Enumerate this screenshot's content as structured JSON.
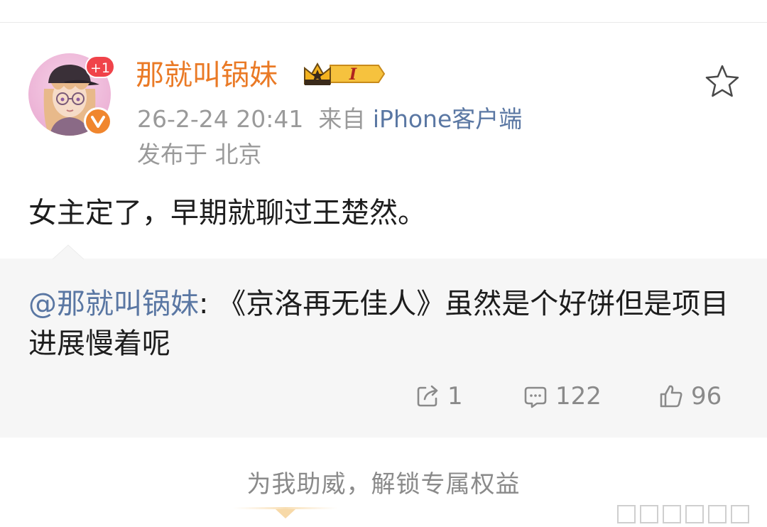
{
  "post": {
    "username": "那就叫锅妹",
    "notification_count": "+1",
    "vip_level": "I",
    "timestamp": "26-2-24 20:41",
    "source_prefix": "来自",
    "source_client": "iPhone客户端",
    "location": "发布于 北京",
    "text": "女主定了，早期就聊过王楚然。"
  },
  "repost": {
    "mention": "@那就叫锅妹",
    "separator": ": ",
    "text": "《京洛再无佳人》虽然是个好饼但是项目进展慢着呢"
  },
  "actions": {
    "share_count": "1",
    "comment_count": "122",
    "like_count": "96"
  },
  "promo": {
    "label": "为我助威，解锁专属权益"
  },
  "colors": {
    "username": "#ea7a26",
    "link": "#5a77a3",
    "meta": "#9a9a9a",
    "badge_red": "#f0434a",
    "verified_orange": "#f0862e",
    "repost_bg": "#f6f6f6"
  },
  "icons": {
    "verified": "v-badge-icon",
    "vip": "crown-badge-icon",
    "favorite": "star-outline-icon",
    "share": "share-icon",
    "comment": "comment-icon",
    "like": "thumbs-up-icon"
  }
}
